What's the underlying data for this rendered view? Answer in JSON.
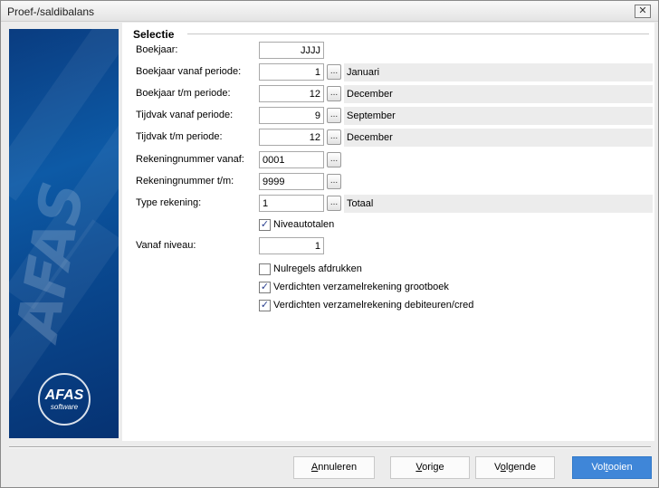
{
  "window": {
    "title": "Proef-/saldibalans",
    "close_symbol": "✕"
  },
  "banner": {
    "brand_text": "AFAS",
    "logo_line1": "AFAS",
    "logo_line2": "software"
  },
  "section": {
    "title": "Selectie"
  },
  "fields": [
    {
      "label": "Boekjaar:",
      "value": "JJJJ",
      "has_lookup": false,
      "description": null
    },
    {
      "label": "Boekjaar vanaf periode:",
      "value": "1",
      "has_lookup": true,
      "description": "Januari"
    },
    {
      "label": "Boekjaar t/m periode:",
      "value": "12",
      "has_lookup": true,
      "description": "December"
    },
    {
      "label": "Tijdvak vanaf periode:",
      "value": "9",
      "has_lookup": true,
      "description": "September"
    },
    {
      "label": "Tijdvak t/m periode:",
      "value": "12",
      "has_lookup": true,
      "description": "December"
    },
    {
      "label": "Rekeningnummer vanaf:",
      "value": "0001",
      "has_lookup": true,
      "description": null
    },
    {
      "label": "Rekeningnummer t/m:",
      "value": "9999",
      "has_lookup": true,
      "description": null
    },
    {
      "label": "Type rekening:",
      "value": "1",
      "has_lookup": true,
      "description": "Totaal"
    }
  ],
  "lookup_label": "...",
  "niveautotalen": {
    "label": "Niveautotalen",
    "checked": true
  },
  "vanaf_niveau": {
    "label": "Vanaf niveau:",
    "value": "1"
  },
  "options": [
    {
      "label": "Nulregels afdrukken",
      "checked": false
    },
    {
      "label": "Verdichten verzamelrekening grootboek",
      "checked": true
    },
    {
      "label": "Verdichten verzamelrekening debiteuren/cred",
      "checked": true
    }
  ],
  "buttons": {
    "cancel": {
      "pre": "",
      "key": "A",
      "post": "nnuleren"
    },
    "prev": {
      "pre": "",
      "key": "V",
      "post": "orige"
    },
    "next": {
      "pre": "V",
      "key": "o",
      "post": "lgende"
    },
    "finish": {
      "pre": "Vol",
      "key": "t",
      "post": "ooien"
    }
  },
  "colors": {
    "banner_blue": "#0d5aa6",
    "primary_button": "#3f86d8",
    "check_mark": "#2a3f8f"
  }
}
